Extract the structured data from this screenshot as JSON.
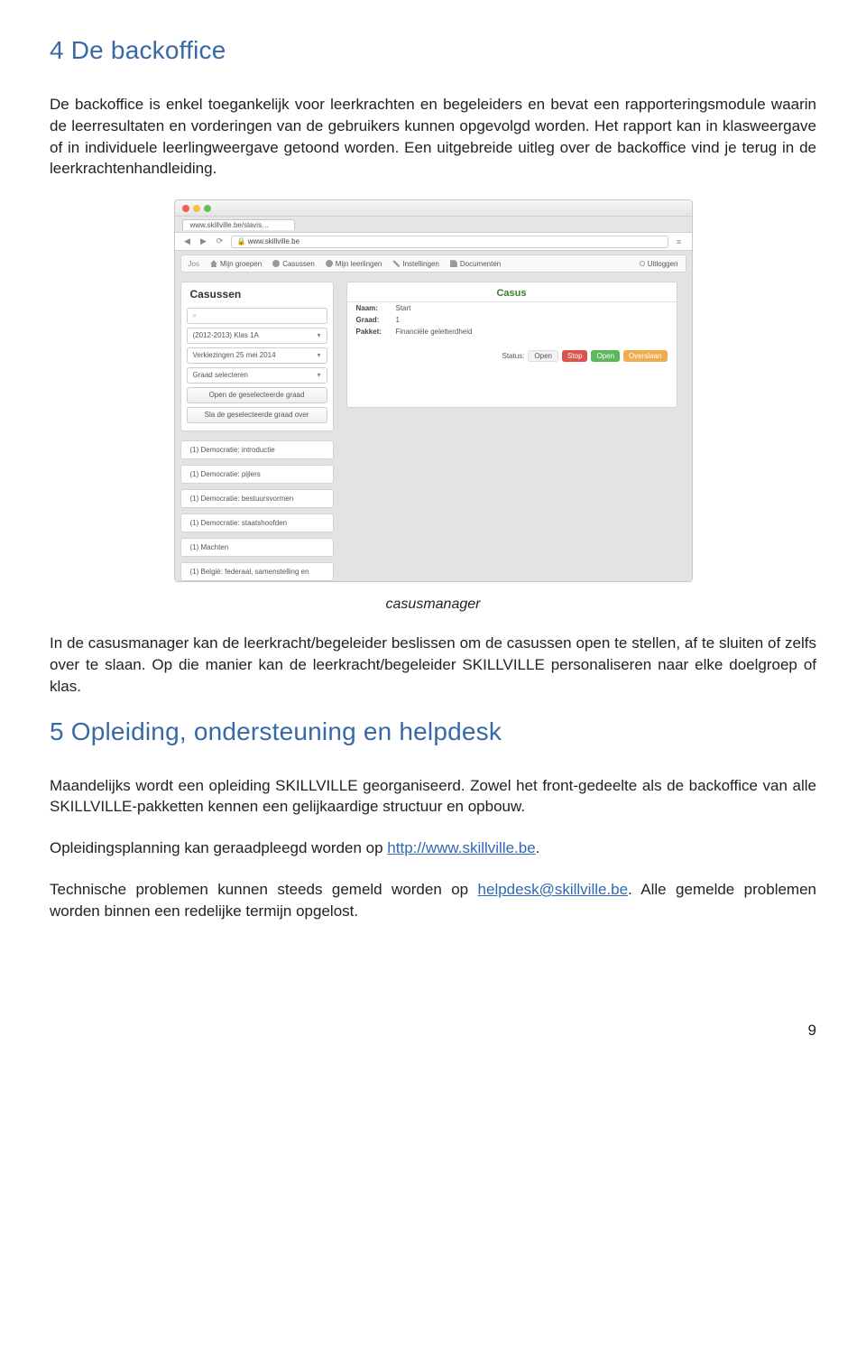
{
  "section4": {
    "title": "4  De backoffice",
    "p1": "De backoffice is enkel toegankelijk voor leerkrachten en begeleiders en bevat een rapporteringsmodule waarin de leerresultaten en vorderingen van de gebruikers kunnen opgevolgd worden. Het rapport kan in klasweergave of in individuele leerlingweergave getoond worden. Een uitgebreide uitleg over de backoffice vind je terug in de leerkrachtenhandleiding.",
    "caption": "casusmanager",
    "p2a": "In de casusmanager kan de leerkracht/begeleider beslissen om de casussen open te stellen, af te sluiten of zelfs over te slaan. Op die manier kan de leerkracht/begeleider SKILLVILLE personaliseren naar elke doelgroep of klas."
  },
  "section5": {
    "title": "5  Opleiding, ondersteuning en helpdesk",
    "p1": "Maandelijks wordt een opleiding SKILLVILLE georganiseerd. Zowel het front-gedeelte als de backoffice van alle SKILLVILLE-pakketten kennen een gelijkaardige structuur en opbouw.",
    "p2_pre": "Opleidingsplanning kan geraadpleegd worden op ",
    "p2_link": "http://www.skillville.be",
    "p2_post": ".",
    "p3_pre": "Technische problemen kunnen steeds gemeld worden op ",
    "p3_link": "helpdesk@skillville.be",
    "p3_post": ". Alle gemelde problemen worden binnen een redelijke termijn opgelost."
  },
  "pagenum": "9",
  "screenshot": {
    "tab_label": "www.skillville.be/slavis…",
    "url": "www.skillville.be",
    "user": "Jos",
    "menu": {
      "groepen": "Mijn groepen",
      "casussen": "Casussen",
      "leerlingen": "Mijn leerlingen",
      "instellingen": "Instellingen",
      "documenten": "Documenten",
      "uitloggen": "Uitloggen"
    },
    "left_panel_title": "Casussen",
    "selects": {
      "klas": "(2012-2013) Klas 1A",
      "datum": "Verkiezingen 25 mei 2014",
      "graad": "Graad selecteren"
    },
    "buttons": {
      "open_graad": "Open de geselecteerde graad",
      "sla_over": "Sla de geselecteerde graad over"
    },
    "casus_title": "Casus",
    "fields": {
      "naam_k": "Naam:",
      "naam_v": "Start",
      "graad_k": "Graad:",
      "graad_v": "1",
      "pakket_k": "Pakket:",
      "pakket_v": "Financiële geletterdheid"
    },
    "status_label": "Status:",
    "status_value": "Open",
    "status_buttons": {
      "stop": "Stop",
      "open": "Open",
      "overslaan": "Overslaan"
    },
    "list": [
      "(1) Democratie: introductie",
      "(1) Democratie: pijlers",
      "(1) Democratie: bestuursvormen",
      "(1) Democratie: staatshoofden",
      "(1) Machten",
      "(1) België: federaal, samenstelling en"
    ]
  }
}
